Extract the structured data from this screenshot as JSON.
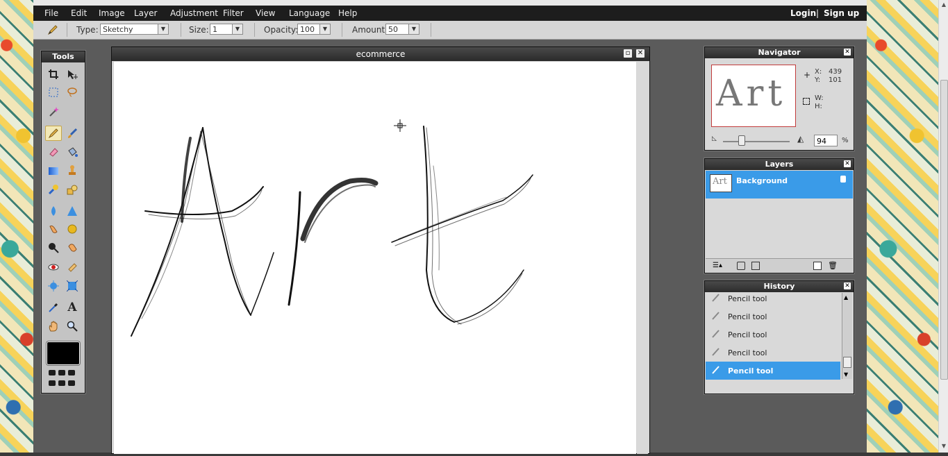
{
  "menubar": {
    "items": [
      "File",
      "Edit",
      "Image",
      "Layer",
      "Adjustment",
      "Filter",
      "View",
      "Language",
      "Help"
    ],
    "login": "Login",
    "divider": "|",
    "signup": "Sign up"
  },
  "options": {
    "type_label": "Type:",
    "type_value": "Sketchy",
    "size_label": "Size:",
    "size_value": "1",
    "opacity_label": "Opacity:",
    "opacity_value": "100",
    "amount_label": "Amount:",
    "amount_value": "50"
  },
  "tools": {
    "title": "Tools",
    "active": "pencil",
    "color": "#000000"
  },
  "document": {
    "title": "ecommerce",
    "drawing_text": "Art"
  },
  "navigator": {
    "title": "Navigator",
    "x_label": "X:",
    "x_value": "439",
    "y_label": "Y:",
    "y_value": "101",
    "w_label": "W:",
    "h_label": "H:",
    "zoom": "94",
    "zoom_unit": "%",
    "thumb_text": "Art"
  },
  "layers": {
    "title": "Layers",
    "items": [
      {
        "name": "Background",
        "selected": true,
        "locked": true
      }
    ]
  },
  "history": {
    "title": "History",
    "items": [
      {
        "label": "Pencil tool",
        "selected": false
      },
      {
        "label": "Pencil tool",
        "selected": false
      },
      {
        "label": "Pencil tool",
        "selected": false
      },
      {
        "label": "Pencil tool",
        "selected": false
      },
      {
        "label": "Pencil tool",
        "selected": true
      }
    ]
  },
  "colors": {
    "menubar": "#1d1d1d",
    "accent": "#3a9be8",
    "workspace": "#5b5b5b"
  }
}
